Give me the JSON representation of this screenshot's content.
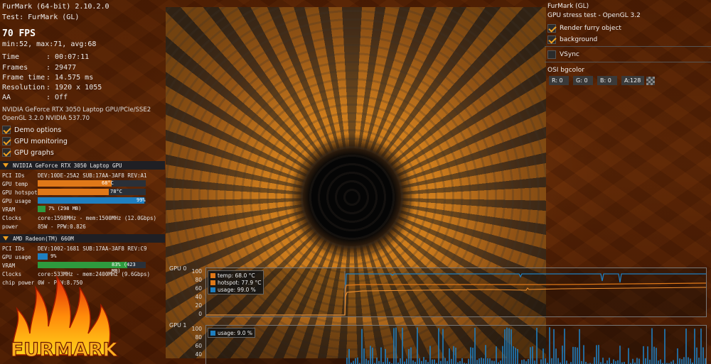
{
  "app": {
    "title": "FurMark (64-bit) 2.10.2.0",
    "test": "Test: FurMark (GL)",
    "fps": "70 FPS",
    "fps_stats": "min:52, max:71, avg:68"
  },
  "stats": [
    {
      "label": "Time",
      "value": ": 00:07:11"
    },
    {
      "label": "Frames",
      "value": ": 29477"
    },
    {
      "label": "Frame time",
      "value": ": 14.575 ms"
    },
    {
      "label": "Resolution",
      "value": ": 1920 x 1055"
    },
    {
      "label": "AA",
      "value": ": Off"
    }
  ],
  "renderer": {
    "line1": "NVIDIA GeForce RTX 3050 Laptop GPU/PCIe/SSE2",
    "line2": "OpenGL 3.2.0 NVIDIA 537.70"
  },
  "left_options": [
    {
      "label": "Demo options",
      "checked": true
    },
    {
      "label": "GPU monitoring",
      "checked": true
    },
    {
      "label": "GPU graphs",
      "checked": true
    }
  ],
  "gpu0": {
    "name": "NVIDIA GeForce RTX 3050 Laptop GPU",
    "pci": "DEV:10DE-25A2 SUB:17AA-3AF8 REV:A1",
    "temp_label": "GPU temp",
    "temp_value": "68°C",
    "temp_fraction": 0.68,
    "hotspot_label": "GPU hotspot",
    "hotspot_value": "78°C",
    "hotspot_fraction": 0.66,
    "usage_label": "GPU usage",
    "usage_value": "99%",
    "usage_fraction": 0.99,
    "vram_label": "VRAM",
    "vram_value": "7% (298 MB)",
    "vram_fraction": 0.07,
    "clocks_label": "Clocks",
    "clocks_value": "core:1598MHz - mem:1500MHz (12.0Gbps)",
    "power_label": "power",
    "power_value": "85W - PPW:0.826",
    "pci_label": "PCI IDs"
  },
  "gpu1": {
    "name": "AMD Radeon(TM) 660M",
    "pci_label": "PCI IDs",
    "pci": "DEV:1002-1681 SUB:17AA-3AF8 REV:C9",
    "usage_label": "GPU usage",
    "usage_value": "9%",
    "usage_fraction": 0.09,
    "vram_label": "VRAM",
    "vram_value": "83% (423 MB)",
    "vram_fraction": 0.83,
    "clocks_label": "Clocks",
    "clocks_value": "core:533MHz - mem:2400MHz (9.6Gbps)",
    "power_label": "chip power",
    "power_value": "0W - PPW:8.750"
  },
  "logo_text": "FURMARK",
  "right_panel": {
    "title": "FurMark (GL)",
    "subtitle": "GPU stress test - OpenGL 3.2",
    "options": [
      {
        "label": "Render furry object",
        "checked": true
      },
      {
        "label": "background",
        "checked": true
      }
    ],
    "vsync": {
      "label": "VSync",
      "checked": false
    },
    "osi_label": "OSI bgcolor",
    "color": {
      "r": "R: 0",
      "g": "G: 0",
      "b": "B: 0",
      "a": "A:128"
    }
  },
  "graphs": {
    "gpu0": {
      "title": "GPU 0",
      "ticks": [
        "100",
        "80",
        "60",
        "40",
        "20",
        "0"
      ],
      "legend": [
        {
          "label": "temp: 68.0 °C",
          "color": "#e07818"
        },
        {
          "label": "hotspot: 77.9 °C",
          "color": "#e07818"
        },
        {
          "label": "usage: 99.0 %",
          "color": "#1f7fc0"
        }
      ]
    },
    "gpu1": {
      "title": "GPU 1",
      "ticks": [
        "100",
        "80",
        "60",
        "40",
        "20",
        "0"
      ],
      "legend": [
        {
          "label": "usage: 9.0 %",
          "color": "#1f7fc0"
        }
      ]
    }
  },
  "colors": {
    "accent": "#f0a020",
    "temp": "#e07818",
    "usage": "#1f7fc0",
    "vram": "#2e9a3e"
  }
}
